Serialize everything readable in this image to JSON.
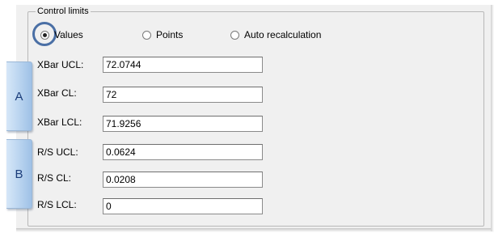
{
  "group": {
    "title": "Control limits"
  },
  "mode": {
    "options": [
      {
        "label": "Values",
        "checked": true
      },
      {
        "label": "Points",
        "checked": false
      },
      {
        "label": "Auto recalculation",
        "checked": false
      }
    ]
  },
  "tabs": {
    "a": "A",
    "b": "B"
  },
  "fields": [
    {
      "label": "XBar UCL:",
      "value": "72.0744"
    },
    {
      "label": "XBar CL:",
      "value": "72"
    },
    {
      "label": "XBar LCL:",
      "value": "71.9256"
    },
    {
      "label": "R/S UCL:",
      "value": "0.0624"
    },
    {
      "label": "R/S CL:",
      "value": "0.0208"
    },
    {
      "label": "R/S LCL:",
      "value": "0"
    }
  ],
  "colors": {
    "tab_text": "#1a3c7a",
    "tab_fill": "#b8d3ef",
    "focus_ring": "#4a6fa5",
    "panel": "#f0f0f0"
  }
}
